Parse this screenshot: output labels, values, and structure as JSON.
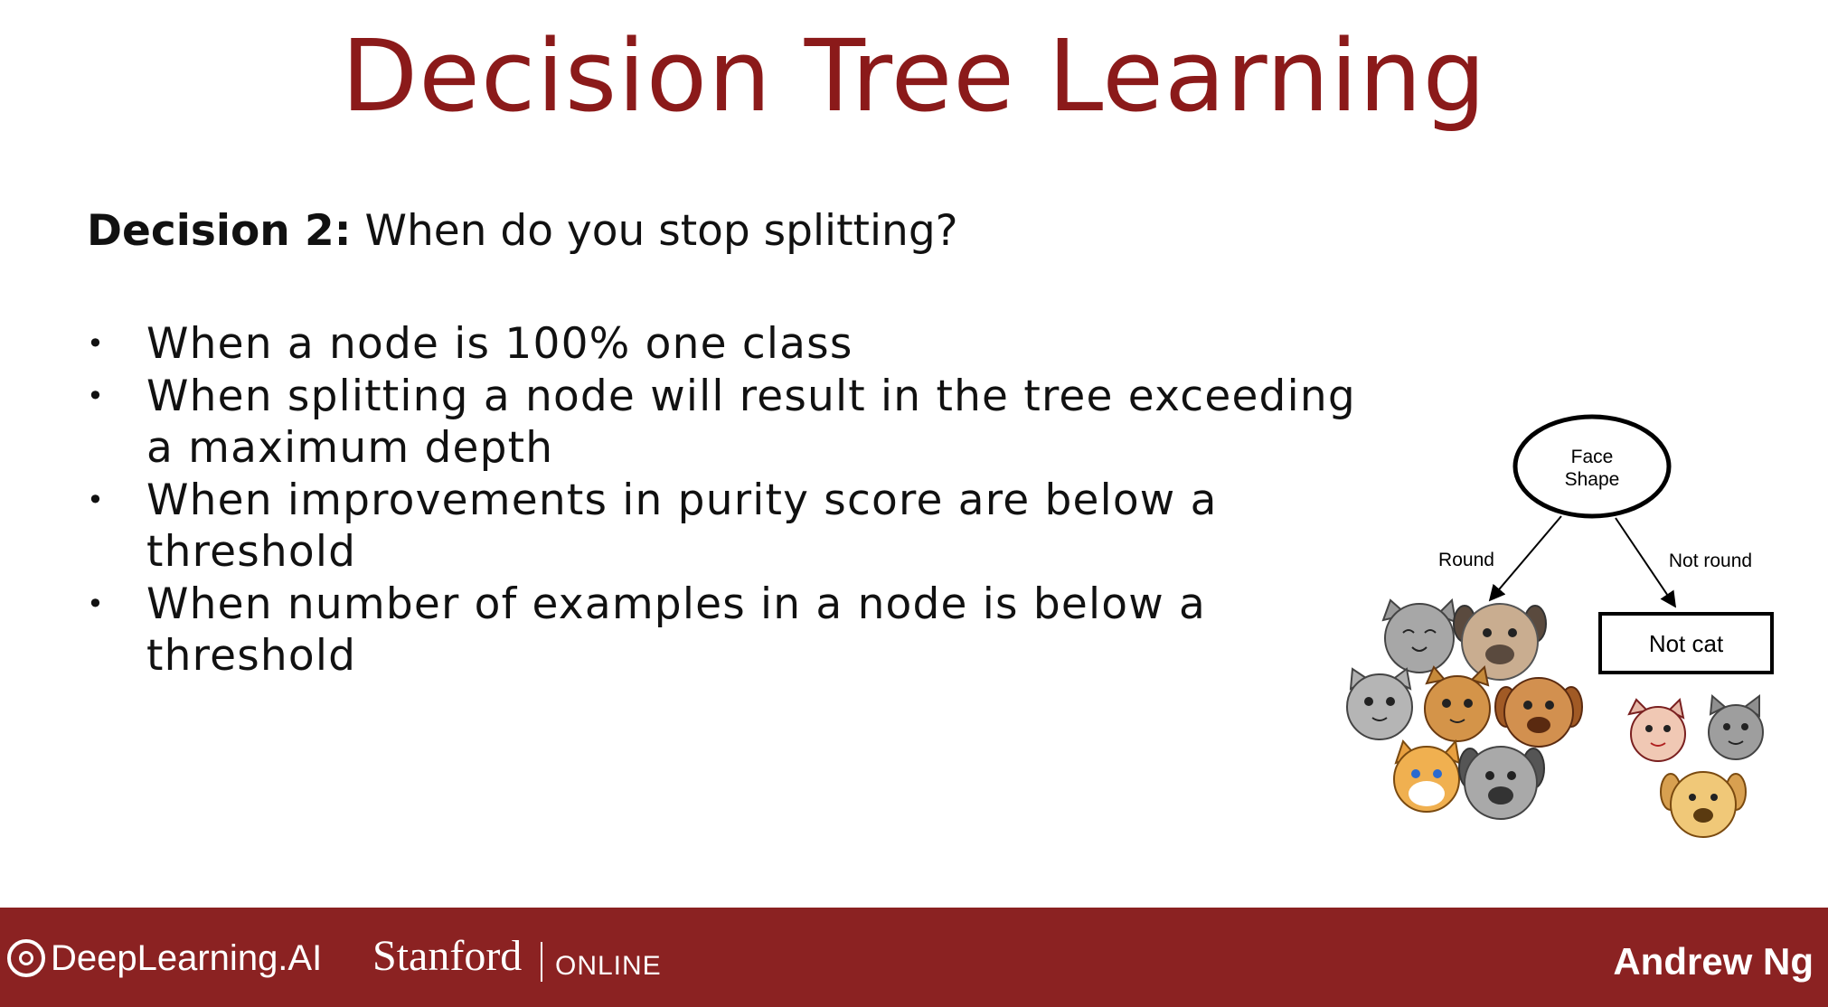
{
  "slide": {
    "title": "Decision Tree Learning",
    "question_label": "Decision 2:",
    "question_text": " When do you stop splitting?",
    "bullet_glyph": "•",
    "bullets": [
      {
        "line1": "When a node is 100% one class",
        "line2": ""
      },
      {
        "line1": "When splitting a node will result in the tree exceeding",
        "line2": "a maximum depth"
      },
      {
        "line1": "When improvements in purity score are below a",
        "line2": "threshold"
      },
      {
        "line1": "When number of examples in a node is below a",
        "line2": "threshold"
      }
    ]
  },
  "diagram": {
    "root_line1": "Face",
    "root_line2": "Shape",
    "left_branch_label": "Round",
    "right_branch_label": "Not round",
    "leaf_label": "Not cat",
    "left_group": [
      "cat",
      "dog",
      "cat",
      "cat",
      "dog",
      "cat",
      "dog"
    ],
    "right_group": [
      "cat",
      "cat",
      "dog"
    ]
  },
  "footer": {
    "brand_deeplearning": "DeepLearning.AI",
    "brand_stanford": "Stanford",
    "brand_online": "ONLINE",
    "author": "Andrew Ng",
    "color": "#8b2222"
  },
  "colors": {
    "title": "#8b1a1a"
  }
}
